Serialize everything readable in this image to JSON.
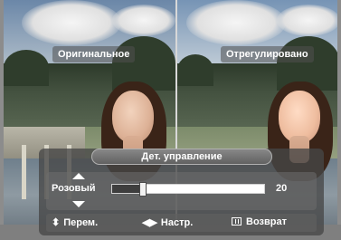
{
  "preview": {
    "original_label": "Оригинальное",
    "adjusted_label": "Отрегулировано"
  },
  "osd": {
    "title": "Дет. управление",
    "setting_label": "Розовый",
    "value": "20",
    "slider_level_percent": 20
  },
  "help": {
    "move_symbol": "⬍",
    "move_label": "Перем.",
    "adjust_symbol": "◀▶",
    "adjust_label": "Настр.",
    "return_label": "Возврат"
  }
}
